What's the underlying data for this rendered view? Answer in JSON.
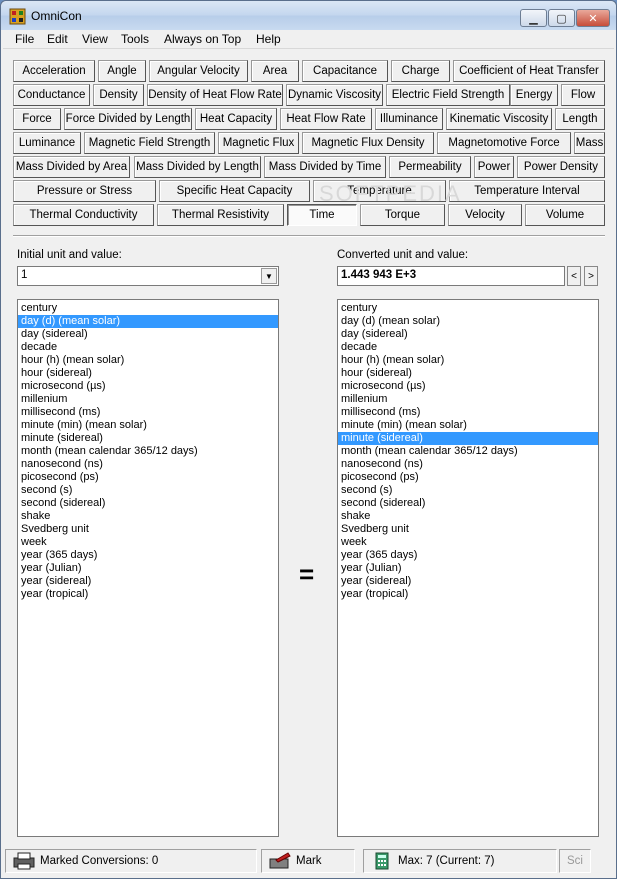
{
  "window": {
    "title": "OmniCon"
  },
  "menu": [
    "File",
    "Edit",
    "View",
    "Tools",
    "Always on Top",
    "Help"
  ],
  "categories": [
    "Acceleration",
    "Angle",
    "Angular Velocity",
    "Area",
    "Capacitance",
    "Charge",
    "Coefficient of Heat Transfer",
    "Conductance",
    "Density",
    "Density of Heat Flow Rate",
    "Dynamic Viscosity",
    "Electric Field Strength",
    "Energy",
    "Flow",
    "Force",
    "Force Divided by Length",
    "Heat Capacity",
    "Heat Flow Rate",
    "Illuminance",
    "Kinematic Viscosity",
    "Length",
    "Luminance",
    "Magnetic Field Strength",
    "Magnetic Flux",
    "Magnetic Flux Density",
    "Magnetomotive Force",
    "Mass",
    "Mass Divided by Area",
    "Mass Divided by Length",
    "Mass Divided by Time",
    "Permeability",
    "Power",
    "Power Density",
    "Pressure or Stress",
    "Specific Heat Capacity",
    "Temperature",
    "Temperature Interval",
    "Thermal Conductivity",
    "Thermal Resistivity",
    "Time",
    "Torque",
    "Velocity",
    "Volume"
  ],
  "selected_category": "Time",
  "watermark": "SOFTPEDIA",
  "left": {
    "label": "Initial unit and value:",
    "value": "1"
  },
  "right": {
    "label": "Converted unit and value:",
    "value": "1.443 943 E+3"
  },
  "units": [
    "century",
    "day (d) (mean solar)",
    "day (sidereal)",
    "decade",
    "hour (h) (mean solar)",
    "hour (sidereal)",
    "microsecond (µs)",
    "millenium",
    "millisecond (ms)",
    "minute (min) (mean solar)",
    "minute (sidereal)",
    "month (mean calendar 365/12 days)",
    "nanosecond (ns)",
    "picosecond (ps)",
    "second (s)",
    "second (sidereal)",
    "shake",
    "Svedberg unit",
    "week",
    "year (365 days)",
    "year (Julian)",
    "year (sidereal)",
    "year (tropical)"
  ],
  "left_selected": "day (d) (mean solar)",
  "right_selected": "minute (sidereal)",
  "equals": "=",
  "nav": {
    "prev": "<",
    "next": ">"
  },
  "status": {
    "marked": "Marked Conversions: 0",
    "mark": "Mark",
    "max": "Max: 7  (Current: 7)",
    "sci": "Sci"
  },
  "colors": {
    "selection": "#3399ff",
    "face": "#f0f0f0"
  }
}
